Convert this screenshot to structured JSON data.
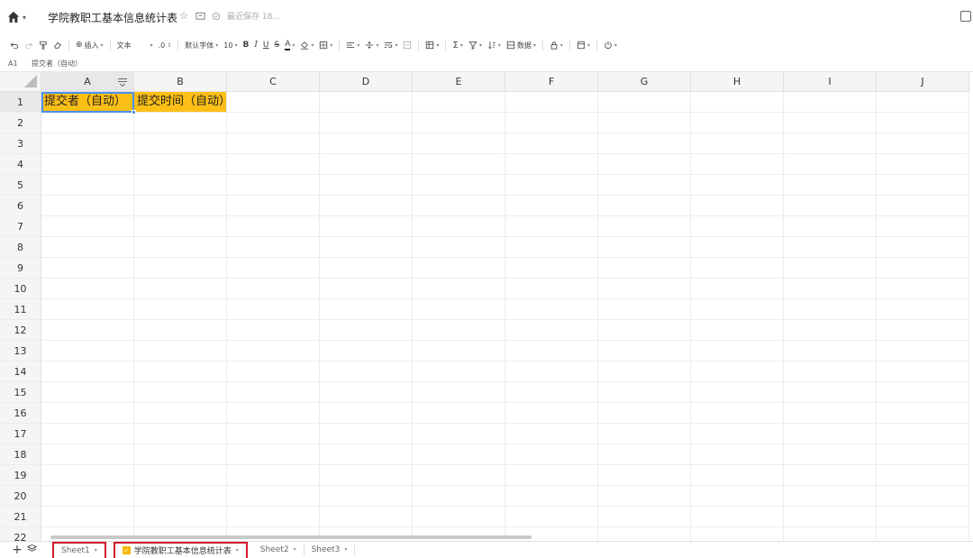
{
  "titlebar": {
    "title": "学院教职工基本信息统计表",
    "save_status": "最近保存 18..."
  },
  "toolbar": {
    "insert_label": "插入",
    "format_label": "文本",
    "decimal_label": ".0",
    "font_label": "默认字体",
    "font_size": "10",
    "bold": "B",
    "italic": "I",
    "underline": "U",
    "strike": "S",
    "font_color_letter": "A",
    "sum_label": "Σ",
    "data_label": "数据"
  },
  "formula_bar": {
    "cell_ref": "A1",
    "content": "提交者（自动）"
  },
  "grid": {
    "columns": [
      "A",
      "B",
      "C",
      "D",
      "E",
      "F",
      "G",
      "H",
      "I",
      "J"
    ],
    "rows": [
      "1",
      "2",
      "3",
      "4",
      "5",
      "6",
      "7",
      "8",
      "9",
      "10",
      "11",
      "12",
      "13",
      "14",
      "15",
      "16",
      "17",
      "18",
      "19",
      "20",
      "21",
      "22"
    ],
    "row1": [
      "提交者（自动）",
      "提交时间（自动）"
    ],
    "header_fill_color": "#fdbf16",
    "selection_color": "#4a8ff0"
  },
  "tabs": [
    {
      "label": "Sheet1"
    },
    {
      "label": "学院教职工基本信息统计表"
    },
    {
      "label": "Sheet2"
    },
    {
      "label": "Sheet3"
    }
  ],
  "tab_add": "+",
  "tab_highlight_color": "#d11a2a"
}
